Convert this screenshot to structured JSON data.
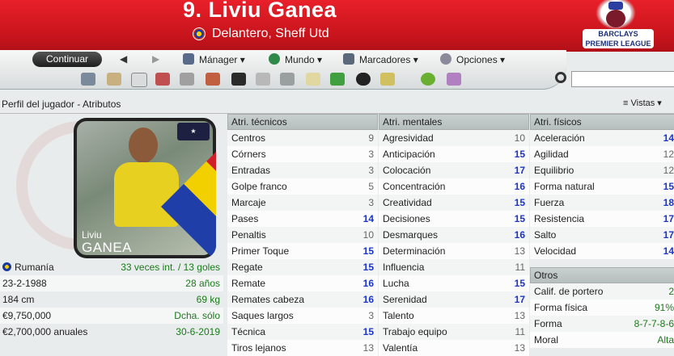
{
  "header": {
    "title": "9. Liviu Ganea",
    "subtitle": "Delantero, Sheff Utd",
    "logo_text": "BARCLAYS PREMIER LEAGUE"
  },
  "toolbar": {
    "continue_label": "Continuar",
    "menus": [
      {
        "label": "Mánager",
        "icon": "manager-icon"
      },
      {
        "label": "Mundo",
        "icon": "globe-icon"
      },
      {
        "label": "Marcadores",
        "icon": "bookmark-icon"
      },
      {
        "label": "Opciones",
        "icon": "options-icon"
      }
    ],
    "search_placeholder": ""
  },
  "breadcrumb": "Perfil del jugador - Atributos",
  "views_label": "Vistas",
  "player": {
    "first_name": "Liviu",
    "last_name": "GANEA",
    "nation": "Rumanía",
    "caps": "33 veces int. / 13 goles",
    "dob": "23-2-1988",
    "age": "28 años",
    "height": "184 cm",
    "weight": "69 kg",
    "value": "€9,750,000",
    "foot": "Dcha. sólo",
    "wage": "€2,700,000 anuales",
    "contract": "30-6-2019"
  },
  "technical": {
    "title": "Atri. técnicos",
    "rows": [
      {
        "name": "Centros",
        "value": "9"
      },
      {
        "name": "Córners",
        "value": "3"
      },
      {
        "name": "Entradas",
        "value": "3"
      },
      {
        "name": "Golpe franco",
        "value": "5"
      },
      {
        "name": "Marcaje",
        "value": "3"
      },
      {
        "name": "Pases",
        "value": "14"
      },
      {
        "name": "Penaltis",
        "value": "10"
      },
      {
        "name": "Primer Toque",
        "value": "15"
      },
      {
        "name": "Regate",
        "value": "15"
      },
      {
        "name": "Remate",
        "value": "16"
      },
      {
        "name": "Remates cabeza",
        "value": "16"
      },
      {
        "name": "Saques largos",
        "value": "3"
      },
      {
        "name": "Técnica",
        "value": "15"
      },
      {
        "name": "Tiros lejanos",
        "value": "13"
      }
    ]
  },
  "mental": {
    "title": "Atri. mentales",
    "rows": [
      {
        "name": "Agresividad",
        "value": "10"
      },
      {
        "name": "Anticipación",
        "value": "15"
      },
      {
        "name": "Colocación",
        "value": "17"
      },
      {
        "name": "Concentración",
        "value": "16"
      },
      {
        "name": "Creatividad",
        "value": "15"
      },
      {
        "name": "Decisiones",
        "value": "15"
      },
      {
        "name": "Desmarques",
        "value": "16"
      },
      {
        "name": "Determinación",
        "value": "13"
      },
      {
        "name": "Influencia",
        "value": "11"
      },
      {
        "name": "Lucha",
        "value": "15"
      },
      {
        "name": "Serenidad",
        "value": "17"
      },
      {
        "name": "Talento",
        "value": "13"
      },
      {
        "name": "Trabajo equipo",
        "value": "11"
      },
      {
        "name": "Valentía",
        "value": "13"
      }
    ]
  },
  "physical": {
    "title": "Atri. físicos",
    "rows": [
      {
        "name": "Aceleración",
        "value": "14"
      },
      {
        "name": "Agilidad",
        "value": "12"
      },
      {
        "name": "Equilibrio",
        "value": "12"
      },
      {
        "name": "Forma natural",
        "value": "15"
      },
      {
        "name": "Fuerza",
        "value": "18"
      },
      {
        "name": "Resistencia",
        "value": "17"
      },
      {
        "name": "Salto",
        "value": "17"
      },
      {
        "name": "Velocidad",
        "value": "14"
      }
    ]
  },
  "other": {
    "title": "Otros",
    "rows": [
      {
        "name": "Calif. de portero",
        "value": "2"
      },
      {
        "name": "Forma física",
        "value": "91%"
      },
      {
        "name": "Forma",
        "value": "8-7-7-8-6"
      },
      {
        "name": "Moral",
        "value": "Alta"
      }
    ]
  },
  "colors": {
    "header_red": "#d0161e",
    "high_value": "#1a35c8",
    "green_text": "#1b7a1b"
  }
}
